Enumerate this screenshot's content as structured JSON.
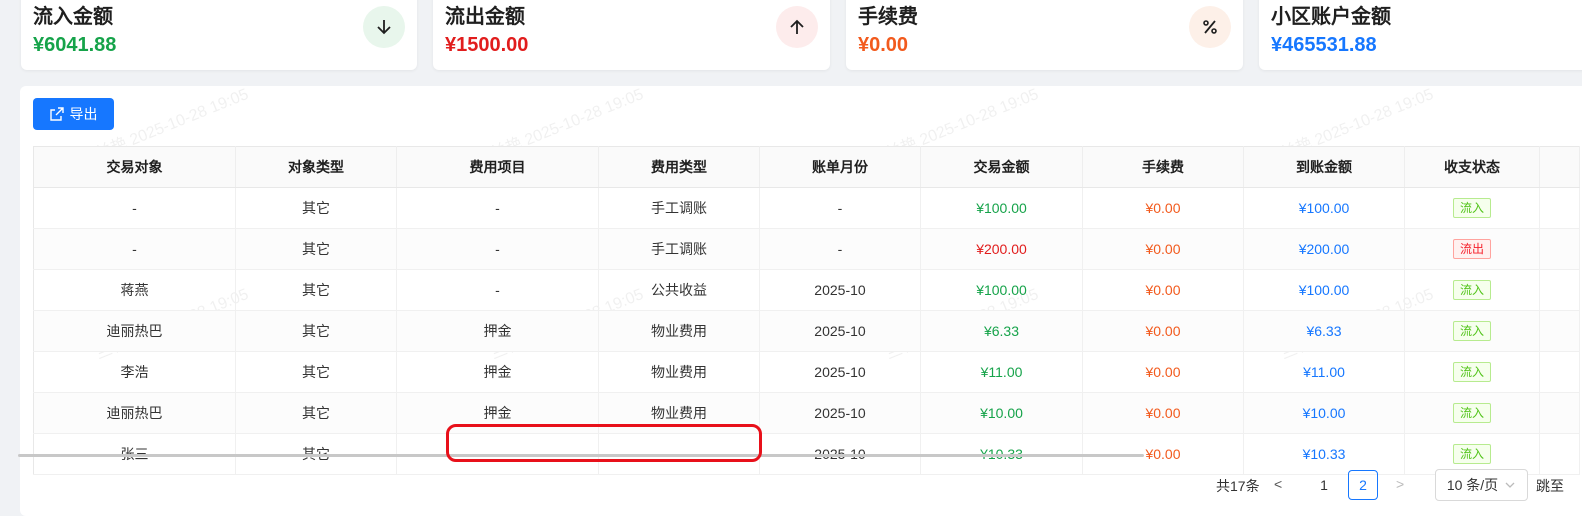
{
  "stats": [
    {
      "title": "流入金额",
      "value": "¥6041.88",
      "color": "#16a34a",
      "icon": "arrow-down-icon",
      "icon_bg": "#e8f6ec",
      "icon_color": "#16a34a"
    },
    {
      "title": "流出金额",
      "value": "¥1500.00",
      "color": "#e11d1d",
      "icon": "arrow-up-icon",
      "icon_bg": "#fdecec",
      "icon_color": "#e11d1d"
    },
    {
      "title": "手续费",
      "value": "¥0.00",
      "color": "#f25a1d",
      "icon": "percent-icon",
      "icon_bg": "#fdf0e8",
      "icon_color": "#333333"
    },
    {
      "title": "小区账户金额",
      "value": "¥465531.88",
      "color": "#1677ff",
      "icon": "",
      "icon_bg": "",
      "icon_color": ""
    }
  ],
  "toolbar": {
    "export_label": "导出",
    "export_icon": "export-icon"
  },
  "table": {
    "headers": [
      "交易对象",
      "对象类型",
      "费用项目",
      "费用类型",
      "账单月份",
      "交易金额",
      "手续费",
      "到账金额",
      "收支状态"
    ],
    "rows": [
      {
        "object": "-",
        "type": "其它",
        "item": "-",
        "fee_type": "手工调账",
        "month": "-",
        "amount": "¥100.00",
        "fee": "¥0.00",
        "received": "¥100.00",
        "status": "流入"
      },
      {
        "object": "-",
        "type": "其它",
        "item": "-",
        "fee_type": "手工调账",
        "month": "-",
        "amount": "¥200.00",
        "fee": "¥0.00",
        "received": "¥200.00",
        "status": "流出"
      },
      {
        "object": "蒋燕",
        "type": "其它",
        "item": "-",
        "fee_type": "公共收益",
        "month": "2025-10",
        "amount": "¥100.00",
        "fee": "¥0.00",
        "received": "¥100.00",
        "status": "流入"
      },
      {
        "object": "迪丽热巴",
        "type": "其它",
        "item": "押金",
        "fee_type": "物业费用",
        "month": "2025-10",
        "amount": "¥6.33",
        "fee": "¥0.00",
        "received": "¥6.33",
        "status": "流入"
      },
      {
        "object": "李浩",
        "type": "其它",
        "item": "押金",
        "fee_type": "物业费用",
        "month": "2025-10",
        "amount": "¥11.00",
        "fee": "¥0.00",
        "received": "¥11.00",
        "status": "流入"
      },
      {
        "object": "迪丽热巴",
        "type": "其它",
        "item": "押金",
        "fee_type": "物业费用",
        "month": "2025-10",
        "amount": "¥10.00",
        "fee": "¥0.00",
        "received": "¥10.00",
        "status": "流入"
      },
      {
        "object": "张三",
        "type": "其它",
        "item": "-",
        "fee_type": "",
        "month": "2025-10",
        "amount": "¥10.33",
        "fee": "¥0.00",
        "received": "¥10.33",
        "status": "流入"
      }
    ]
  },
  "pagination": {
    "total": "共17条",
    "prev": "<",
    "pages": [
      "1",
      "2"
    ],
    "current": "2",
    "next": ">",
    "page_size": "10 条/页",
    "jump": "跳至"
  },
  "watermark": "兰艳 2025-10-28 19:05",
  "colors": {
    "inflow": "#16a34a",
    "outflow": "#e11d1d",
    "fee": "#f25a1d",
    "received": "#1677ff",
    "primary": "#1677ff",
    "highlight": "#e8101a"
  }
}
